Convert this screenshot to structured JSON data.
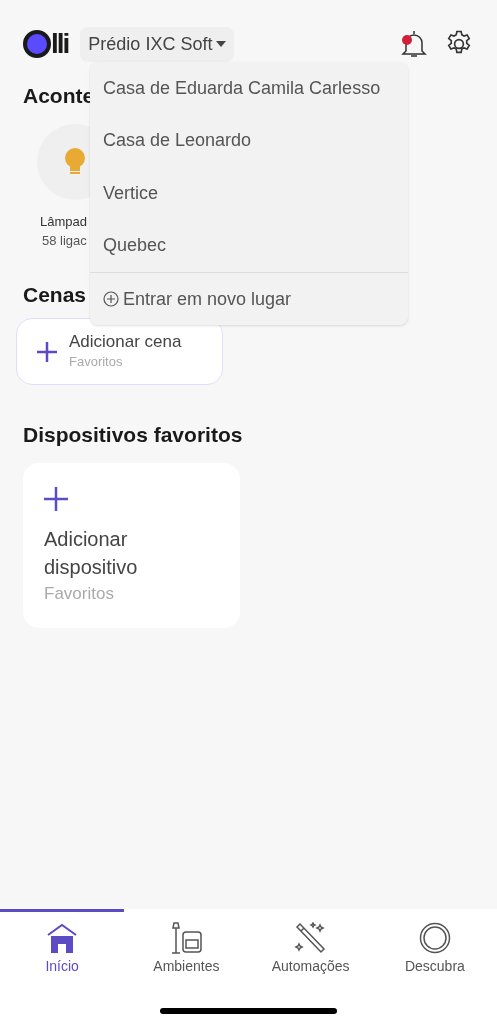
{
  "header": {
    "logo_text": "lli",
    "place": "Prédio IXC Soft",
    "notification": true
  },
  "events": {
    "title": "Aconte",
    "devices": [
      {
        "name": "Lâmpad",
        "detail": "58 ligac"
      }
    ]
  },
  "dropdown": {
    "items": [
      {
        "label": "Casa de Eduarda Camila Carlesso"
      },
      {
        "label": "Casa de Leonardo"
      },
      {
        "label": "Vertice"
      },
      {
        "label": "Quebec"
      }
    ],
    "action": "Entrar em novo lugar"
  },
  "scenes": {
    "title": "Cenas",
    "add_label": "Adicionar cena",
    "add_sub": "Favoritos"
  },
  "favorites": {
    "title": "Dispositivos favoritos",
    "add_label": "Adicionar dispositivo",
    "add_sub": "Favoritos"
  },
  "tabs": [
    {
      "label": "Início",
      "kind": "home",
      "selected": true
    },
    {
      "label": "Ambientes",
      "kind": "rooms",
      "selected": false
    },
    {
      "label": "Automações",
      "kind": "automations",
      "selected": false
    },
    {
      "label": "Descubra",
      "kind": "discover",
      "selected": false
    }
  ]
}
